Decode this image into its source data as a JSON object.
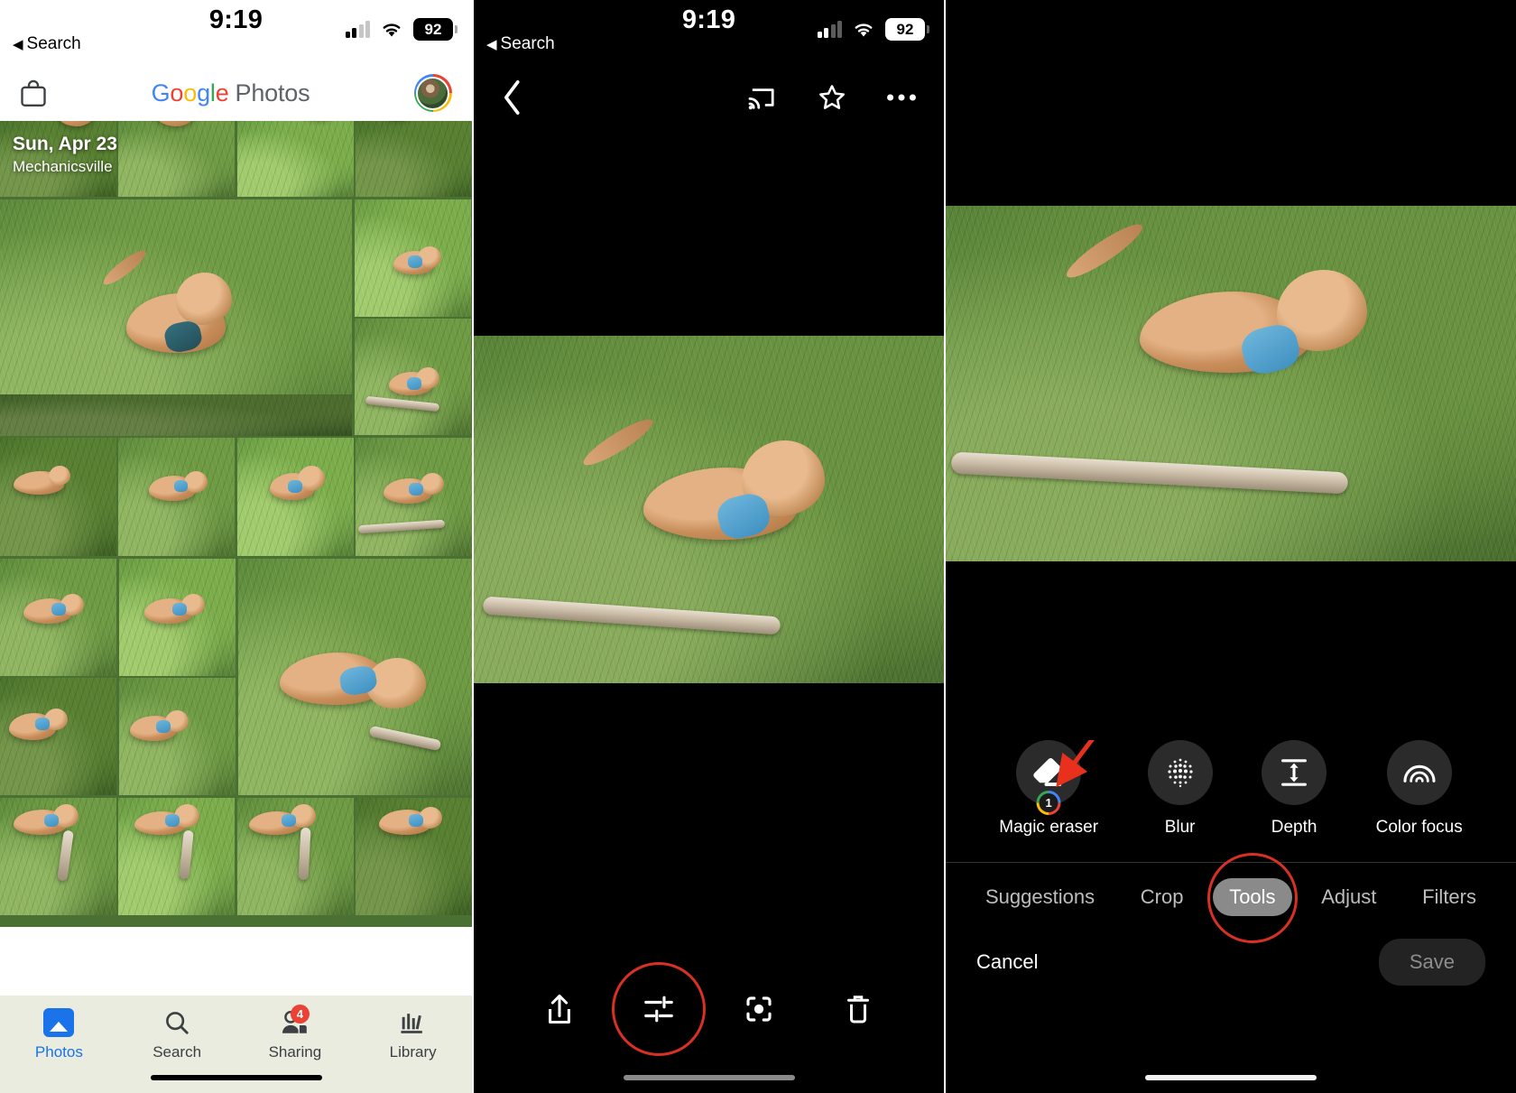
{
  "status_bar": {
    "time": "9:19",
    "back_label": "Search",
    "back_glyph": "◀",
    "battery": "92"
  },
  "panel_library": {
    "header": {
      "bag_icon": "shopping-bag-icon",
      "logo": {
        "g": "G",
        "o1": "o",
        "o2": "o",
        "g2": "g",
        "l": "l",
        "e": "e",
        "word": "Photos"
      },
      "avatar": "user-avatar"
    },
    "group": {
      "date": "Sun, Apr 23",
      "location": "Mechanicsville"
    },
    "nav": [
      {
        "label": "Photos",
        "icon": "photos-icon",
        "active": true,
        "badge": ""
      },
      {
        "label": "Search",
        "icon": "search-icon",
        "active": false,
        "badge": ""
      },
      {
        "label": "Sharing",
        "icon": "sharing-icon",
        "active": false,
        "badge": "4"
      },
      {
        "label": "Library",
        "icon": "library-icon",
        "active": false,
        "badge": ""
      }
    ]
  },
  "panel_viewer": {
    "top_bar": {
      "back": "back-chevron-icon",
      "cast": "cast-icon",
      "favorite": "star-icon",
      "more": "more-options-icon"
    },
    "bottom_bar": [
      {
        "name": "share-icon",
        "highlighted": false
      },
      {
        "name": "edit-icon",
        "highlighted": true
      },
      {
        "name": "lens-icon",
        "highlighted": false
      },
      {
        "name": "delete-icon",
        "highlighted": false
      }
    ]
  },
  "panel_editor": {
    "tools": [
      {
        "label": "Magic eraser",
        "icon": "eraser-icon",
        "badge": "1",
        "annotated": true
      },
      {
        "label": "Blur",
        "icon": "blur-dots-icon",
        "badge": "",
        "annotated": false
      },
      {
        "label": "Depth",
        "icon": "depth-icon",
        "badge": "",
        "annotated": false
      },
      {
        "label": "Color focus",
        "icon": "color-focus-icon",
        "badge": "",
        "annotated": false
      }
    ],
    "tabs": [
      {
        "label": "Suggestions",
        "selected": false
      },
      {
        "label": "Crop",
        "selected": false
      },
      {
        "label": "Tools",
        "selected": true
      },
      {
        "label": "Adjust",
        "selected": false
      },
      {
        "label": "Filters",
        "selected": false
      }
    ],
    "actions": {
      "cancel": "Cancel",
      "save": "Save"
    }
  },
  "colors": {
    "accent_blue": "#1a73e8",
    "annotation_red": "#d93025",
    "badge_red": "#ea4335",
    "nav_bg": "#e9ecdf",
    "dark_bg": "#000000"
  }
}
